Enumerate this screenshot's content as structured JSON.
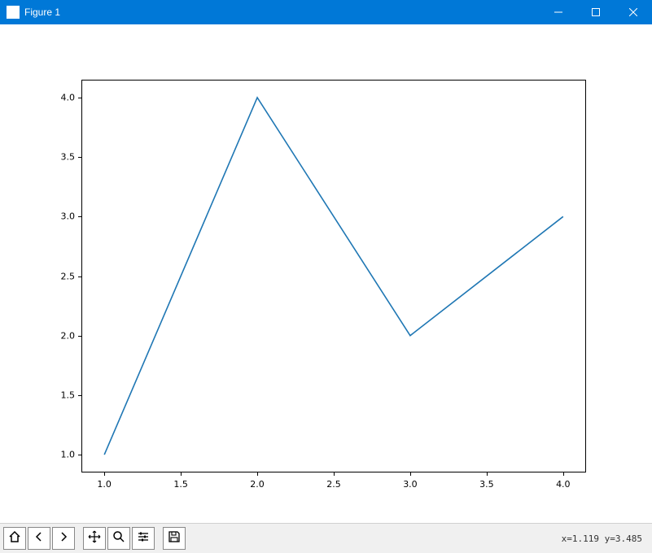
{
  "window": {
    "title": "Figure 1"
  },
  "chart_data": {
    "type": "line",
    "x": [
      1,
      2,
      3,
      4
    ],
    "y": [
      1,
      4,
      2,
      3
    ],
    "xlim": [
      0.85,
      4.15
    ],
    "ylim": [
      0.85,
      4.15
    ],
    "x_ticks": [
      1.0,
      1.5,
      2.0,
      2.5,
      3.0,
      3.5,
      4.0
    ],
    "y_ticks": [
      1.0,
      1.5,
      2.0,
      2.5,
      3.0,
      3.5,
      4.0
    ],
    "x_tick_labels": [
      "1.0",
      "1.5",
      "2.0",
      "2.5",
      "3.0",
      "3.5",
      "4.0"
    ],
    "y_tick_labels": [
      "1.0",
      "1.5",
      "2.0",
      "2.5",
      "3.0",
      "3.5",
      "4.0"
    ],
    "line_color": "#1f77b4"
  },
  "toolbar": {
    "coord_text": "x=1.119 y=3.485"
  }
}
